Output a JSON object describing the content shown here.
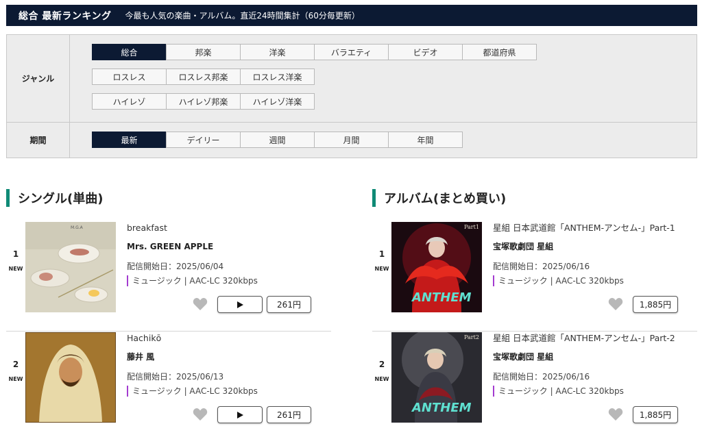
{
  "header": {
    "title": "総合 最新ランキング",
    "subtitle": "今最も人気の楽曲・アルバム。直近24時間集計（60分毎更新）"
  },
  "filters": {
    "genre_label": "ジャンル",
    "genre_rows": [
      [
        "総合",
        "邦楽",
        "洋楽",
        "バラエティ",
        "ビデオ",
        "都道府県"
      ],
      [
        "ロスレス",
        "ロスレス邦楽",
        "ロスレス洋楽"
      ],
      [
        "ハイレゾ",
        "ハイレゾ邦楽",
        "ハイレゾ洋楽"
      ]
    ],
    "genre_selected": "総合",
    "period_label": "期間",
    "period_options": [
      "最新",
      "デイリー",
      "週間",
      "月間",
      "年間"
    ],
    "period_selected": "最新"
  },
  "singles": {
    "heading": "シングル(単曲)",
    "items": [
      {
        "rank": "1",
        "badge": "NEW",
        "title": "breakfast",
        "artist": "Mrs. GREEN APPLE",
        "date": "配信開始日：2025/06/04",
        "format": "ミュージック | AAC-LC 320kbps",
        "price": "261円"
      },
      {
        "rank": "2",
        "badge": "NEW",
        "title": "Hachikō",
        "artist": "藤井 風",
        "date": "配信開始日：2025/06/13",
        "format": "ミュージック | AAC-LC 320kbps",
        "price": "261円"
      }
    ]
  },
  "albums": {
    "heading": "アルバム(まとめ買い)",
    "items": [
      {
        "rank": "1",
        "badge": "NEW",
        "title": "星組 日本武道館「ANTHEM-アンセム-」Part-1",
        "artist": "宝塚歌劇団 星組",
        "date": "配信開始日：2025/06/16",
        "format": "ミュージック | AAC-LC 320kbps",
        "price": "1,885円"
      },
      {
        "rank": "2",
        "badge": "NEW",
        "title": "星組 日本武道館「ANTHEM-アンセム-」Part-2",
        "artist": "宝塚歌劇団 星組",
        "date": "配信開始日：2025/06/16",
        "format": "ミュージック | AAC-LC 320kbps",
        "price": "1,885円"
      }
    ]
  },
  "colors": {
    "header_bg": "#0c1a33",
    "accent_bar": "#0f8a76",
    "format_marker": "#a33bd0"
  },
  "icons": [
    "heart-icon",
    "play-icon"
  ]
}
